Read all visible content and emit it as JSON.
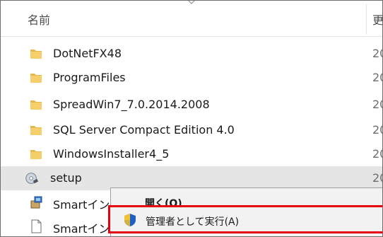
{
  "columns": {
    "name": "名前",
    "date": "更"
  },
  "files": [
    {
      "name": "DotNetFX48",
      "date": "20",
      "icon": "folder-icon"
    },
    {
      "name": "ProgramFiles",
      "date": "20",
      "icon": "folder-icon"
    },
    {
      "name": "SpreadWin7_7.0.2014.2008",
      "date": "20",
      "icon": "folder-icon"
    },
    {
      "name": "SQL Server Compact Edition 4.0",
      "date": "20",
      "icon": "folder-icon"
    },
    {
      "name": "WindowsInstaller4_5",
      "date": "20",
      "icon": "folder-icon"
    },
    {
      "name": "setup",
      "date": "20",
      "icon": "setup-disc-icon",
      "selected": true
    },
    {
      "name": "Smartイン",
      "date": "",
      "icon": "installer-package-icon"
    },
    {
      "name": "Smartイン",
      "date": "",
      "icon": "blank-document-icon"
    }
  ],
  "context_menu": {
    "open": "開く(O)",
    "run_as_admin": "管理者として実行(A)",
    "highlight_color": "#e60012"
  },
  "colors": {
    "folder": "#f0c14b",
    "selected_row": "#e5e5e5",
    "menu_bg": "#f2f2f2"
  }
}
